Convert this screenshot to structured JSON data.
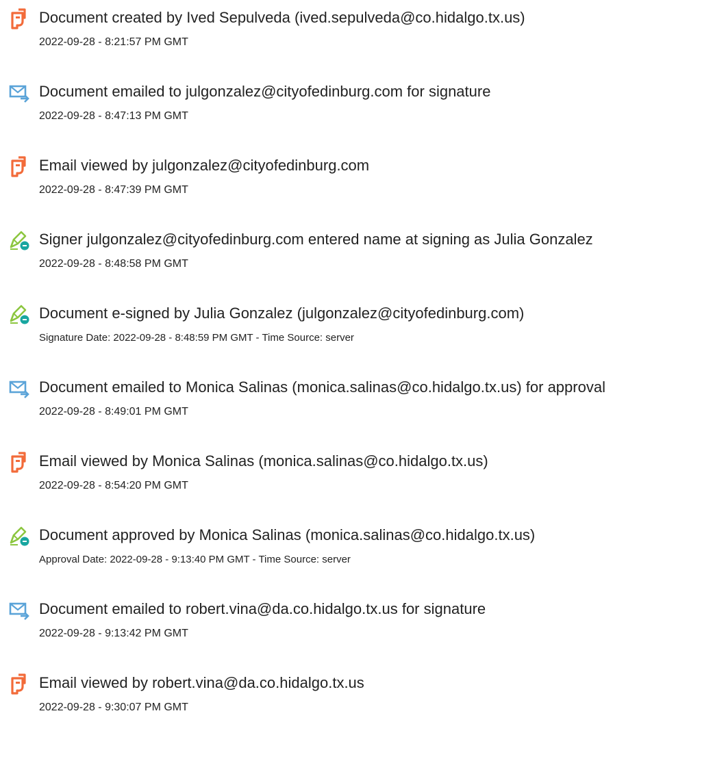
{
  "colors": {
    "viewed_icon": "#f26b3a",
    "email_icon": "#5aa3d8",
    "sign_icon": "#8cc63f",
    "sign_badge": "#18a6a0",
    "text": "#222222"
  },
  "events": [
    {
      "icon": "document-view-icon",
      "title": "Document created by Ived Sepulveda (ived.sepulveda@co.hidalgo.tx.us)",
      "detail": "2022-09-28 - 8:21:57 PM GMT"
    },
    {
      "icon": "email-send-icon",
      "title": "Document emailed to julgonzalez@cityofedinburg.com for signature",
      "detail": "2022-09-28 - 8:47:13 PM GMT"
    },
    {
      "icon": "document-view-icon",
      "title": "Email viewed by julgonzalez@cityofedinburg.com",
      "detail": "2022-09-28 - 8:47:39 PM GMT"
    },
    {
      "icon": "pen-sign-icon",
      "title": "Signer julgonzalez@cityofedinburg.com entered name at signing as Julia Gonzalez",
      "detail": "2022-09-28 - 8:48:58 PM GMT"
    },
    {
      "icon": "pen-sign-icon",
      "title": "Document e-signed by Julia Gonzalez (julgonzalez@cityofedinburg.com)",
      "detail": "Signature Date: 2022-09-28 - 8:48:59 PM GMT - Time Source: server"
    },
    {
      "icon": "email-send-icon",
      "title": "Document emailed to Monica Salinas (monica.salinas@co.hidalgo.tx.us) for approval",
      "detail": "2022-09-28 - 8:49:01 PM GMT"
    },
    {
      "icon": "document-view-icon",
      "title": "Email viewed by Monica Salinas (monica.salinas@co.hidalgo.tx.us)",
      "detail": "2022-09-28 - 8:54:20 PM GMT"
    },
    {
      "icon": "pen-sign-icon",
      "title": "Document approved by Monica Salinas (monica.salinas@co.hidalgo.tx.us)",
      "detail": "Approval Date: 2022-09-28 - 9:13:40 PM GMT - Time Source: server"
    },
    {
      "icon": "email-send-icon",
      "title": "Document emailed to robert.vina@da.co.hidalgo.tx.us for signature",
      "detail": "2022-09-28 - 9:13:42 PM GMT"
    },
    {
      "icon": "document-view-icon",
      "title": "Email viewed by robert.vina@da.co.hidalgo.tx.us",
      "detail": "2022-09-28 - 9:30:07 PM GMT"
    }
  ]
}
